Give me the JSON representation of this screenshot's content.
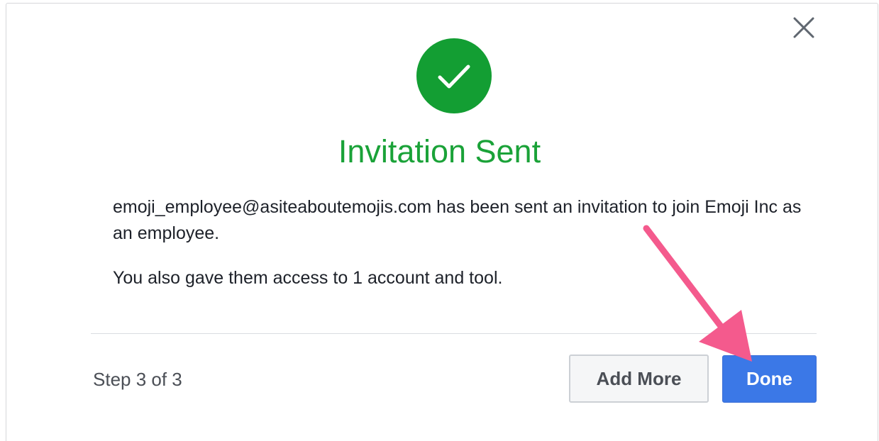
{
  "dialog": {
    "close_icon": "close-icon",
    "status_icon": "checkmark-icon",
    "title": "Invitation Sent",
    "message_line1": "emoji_employee@asiteaboutemojis.com has been sent an invitation to join Emoji Inc as an employee.",
    "message_line2": "You also gave them access to 1 account and tool.",
    "step_text": "Step 3 of 3",
    "add_more_label": "Add More",
    "done_label": "Done"
  },
  "annotation": {
    "arrow_icon": "pink-arrow-icon",
    "arrow_color": "#f45a8d"
  },
  "colors": {
    "success_green": "#139e33",
    "title_green": "#1aa238",
    "primary_blue": "#3b78e7"
  }
}
